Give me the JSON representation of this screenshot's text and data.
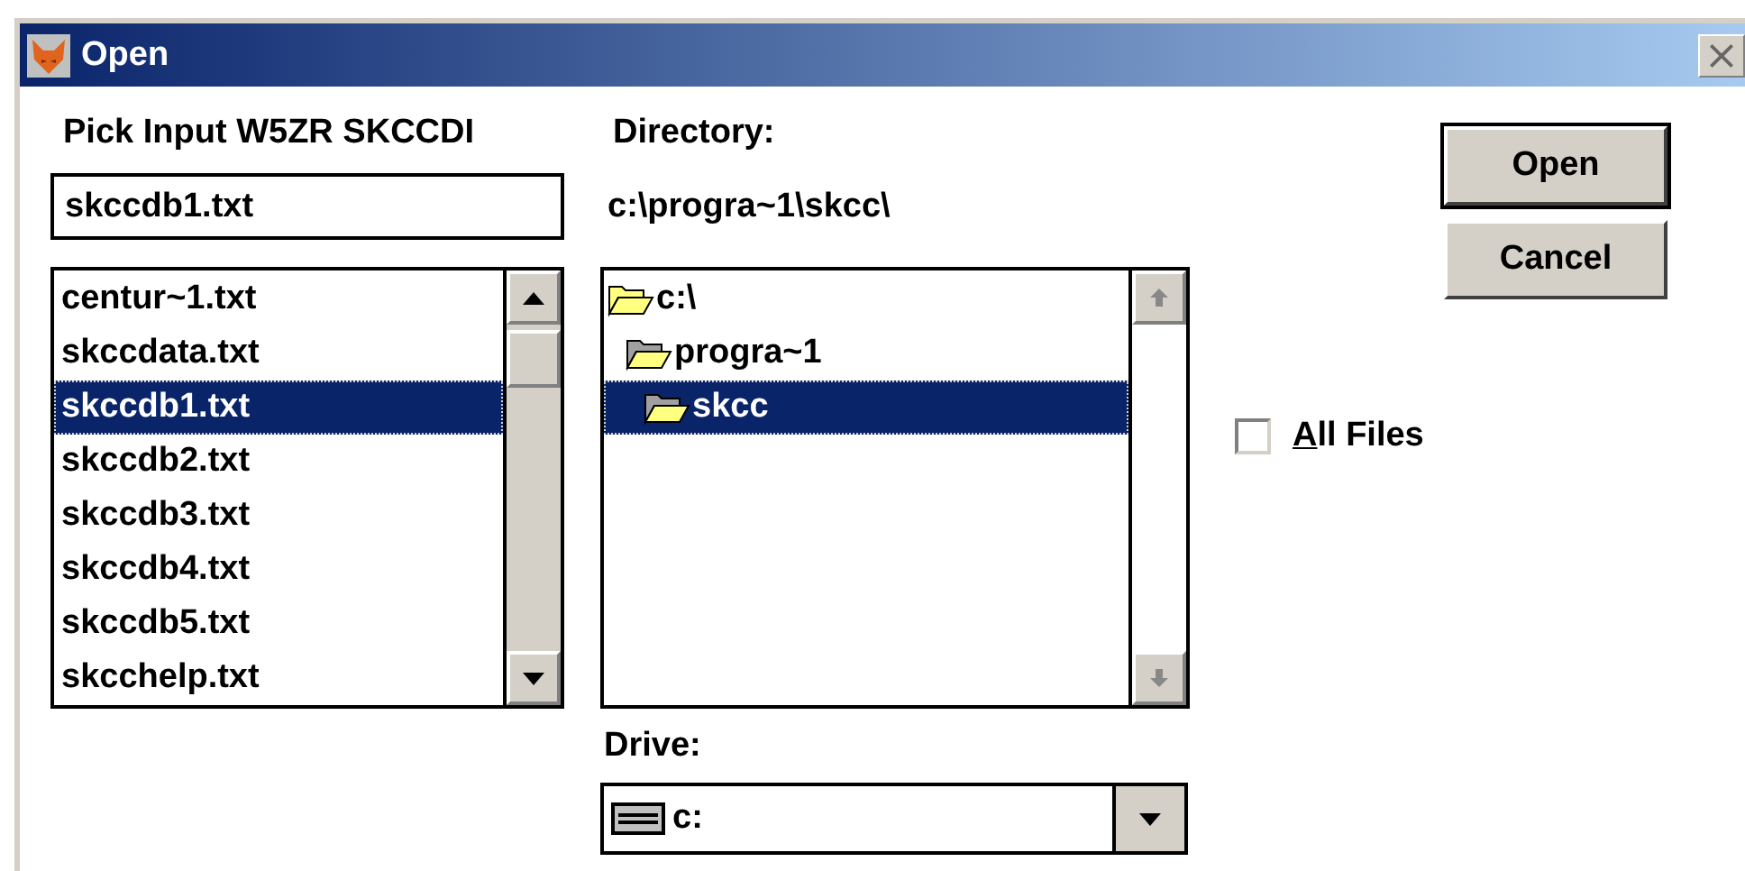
{
  "window": {
    "title": "Open"
  },
  "filename": {
    "label": "Pick Input W5ZR SKCCDI",
    "value": "skccdb1.txt"
  },
  "files": [
    {
      "name": "centur~1.txt",
      "selected": false
    },
    {
      "name": "skccdata.txt",
      "selected": false
    },
    {
      "name": "skccdb1.txt",
      "selected": true
    },
    {
      "name": "skccdb2.txt",
      "selected": false
    },
    {
      "name": "skccdb3.txt",
      "selected": false
    },
    {
      "name": "skccdb4.txt",
      "selected": false
    },
    {
      "name": "skccdb5.txt",
      "selected": false
    },
    {
      "name": "skcchelp.txt",
      "selected": false
    }
  ],
  "directory": {
    "label": "Directory:",
    "path": "c:\\progra~1\\skcc\\",
    "tree": [
      {
        "name": "c:\\",
        "selected": false,
        "children": [
          {
            "name": "progra~1",
            "selected": false,
            "children": [
              {
                "name": "skcc",
                "selected": true
              }
            ]
          }
        ]
      }
    ]
  },
  "drive": {
    "label": "Drive:",
    "value": "c:"
  },
  "all_files": {
    "label": "All Files",
    "checked": false
  },
  "buttons": [
    {
      "label": "Open",
      "default": true
    },
    {
      "label": "Cancel",
      "default": false
    }
  ]
}
